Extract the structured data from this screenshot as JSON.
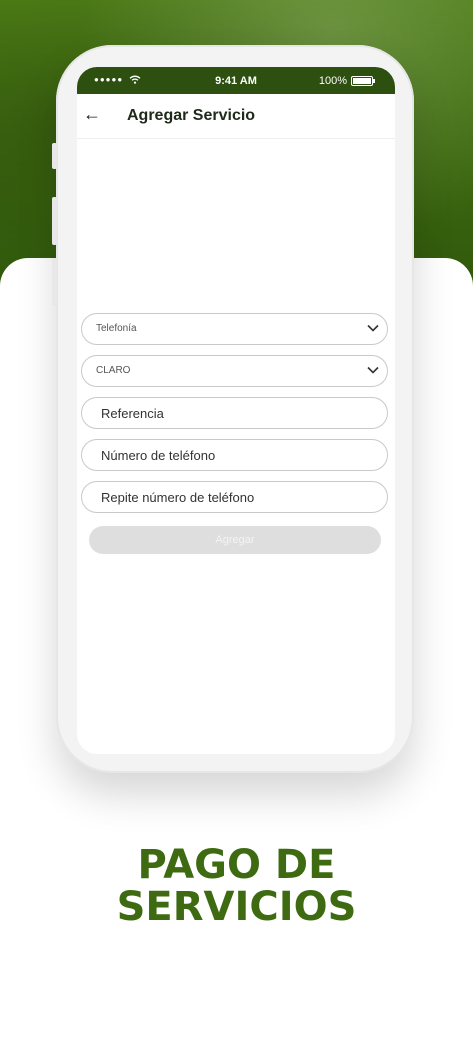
{
  "status_bar": {
    "time": "9:41 AM",
    "battery": "100%"
  },
  "header": {
    "title": "Agregar Servicio"
  },
  "form": {
    "category_select": "Telefonía",
    "provider_select": "CLARO",
    "reference_placeholder": "Referencia",
    "phone_placeholder": "Número de teléfono",
    "phone_confirm_placeholder": "Repite número de teléfono",
    "submit_label": "Agregar"
  },
  "promo": {
    "line1": "PAGO DE",
    "line2": "SERVICIOS"
  },
  "colors": {
    "brand_green": "#3e6b12",
    "status_bar": "#2d4f10",
    "disabled_button": "#dedede"
  }
}
